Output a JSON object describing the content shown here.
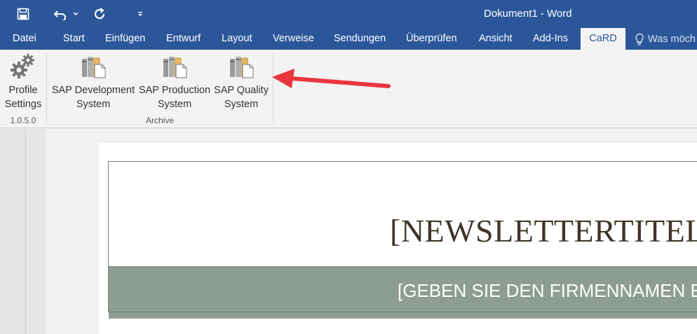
{
  "window": {
    "title": "Dokument1 - Word"
  },
  "quick_access": {
    "save_icon": "save-icon",
    "undo_icon": "undo-icon",
    "redo_icon": "repeat-icon",
    "customize_icon": "customize-qat-icon"
  },
  "tabs": {
    "datei": "Datei",
    "start": "Start",
    "einfuegen": "Einfügen",
    "entwurf": "Entwurf",
    "layout": "Layout",
    "verweise": "Verweise",
    "sendungen": "Sendungen",
    "ueberpruefen": "Überprüfen",
    "ansicht": "Ansicht",
    "addins": "Add-Ins",
    "card": "CaRD",
    "active": "CaRD"
  },
  "tell_me": {
    "text": "Was möch"
  },
  "ribbon": {
    "profile": {
      "line1": "Profile",
      "line2": "Settings",
      "version": "1.0.5.0"
    },
    "archive": {
      "dev_line1": "SAP Development",
      "dev_line2": "System",
      "prod_line1": "SAP Production",
      "prod_line2": "System",
      "qual_line1": "SAP Quality",
      "qual_line2": "System",
      "group_label": "Archive"
    }
  },
  "document": {
    "newsletter_title": "[NEWSLETTERTITEL",
    "company_placeholder": "[GEBEN SIE DEN FIRMENNAMEN E"
  },
  "colors": {
    "ribbon_blue": "#2b579a",
    "band_green": "#8d9d91",
    "arrow_red": "#e8363c"
  }
}
